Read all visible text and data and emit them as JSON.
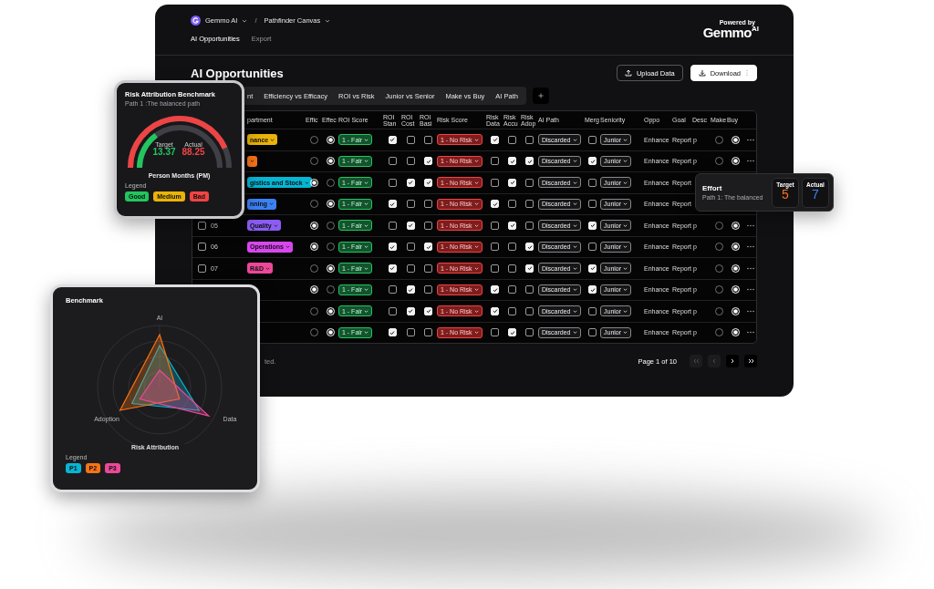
{
  "header": {
    "workspace": "Gemmo AI",
    "separator": "/",
    "project": "Pathfinder Canvas",
    "nav": [
      {
        "label": "AI Opportunities",
        "selected": true
      },
      {
        "label": "Export",
        "selected": false
      }
    ],
    "logo": {
      "badge": "Powered by",
      "name": "Gemmo",
      "suffix": "AI"
    }
  },
  "page_title": "AI Opportunities",
  "actions": [
    {
      "label": "Upload Data",
      "kind": "outline"
    },
    {
      "label": "Download",
      "kind": "primary"
    }
  ],
  "tabs": [
    {
      "label": "nt",
      "selected": false
    },
    {
      "label": "Efficiency vs Efficacy",
      "selected": false
    },
    {
      "label": "ROI vs Risk",
      "selected": false
    },
    {
      "label": "Junior vs Senior",
      "selected": false
    },
    {
      "label": "Make vs Buy",
      "selected": false
    },
    {
      "label": "AI Path",
      "selected": false
    }
  ],
  "table": {
    "columns": [
      "partment",
      "Effic",
      "Effec",
      "ROI Score",
      "ROI Stan",
      "ROI Cost",
      "ROI Basi",
      "Risk Score",
      "Risk Data",
      "Risk Accu",
      "Risk Adop",
      "AI Path",
      "Merg",
      "Seniority",
      "Oppo",
      "Goal",
      "Desc",
      "Make",
      "Buy"
    ],
    "rows": [
      {
        "department": {
          "label": "nance",
          "color": "#eab308"
        },
        "effic": {
          "selected": false
        },
        "effec": {
          "selected": true
        },
        "roi_score": "1 - Fair",
        "roi": [
          {
            "checked": true
          },
          {
            "checked": false
          },
          {
            "checked": false
          }
        ],
        "risk_score": "1 - No Risk",
        "risk": [
          {
            "checked": true
          },
          {
            "checked": false
          },
          {
            "checked": false
          }
        ],
        "ai_path": "Discarded",
        "merge": {
          "checked": false
        },
        "seniority": "Junior",
        "opportunity": "Enhance",
        "goal": "Report p",
        "make": {
          "selected": false
        },
        "buy": {
          "selected": true
        }
      },
      {
        "department": {
          "color": "#f97316"
        },
        "effic": {
          "selected": false
        },
        "effec": {
          "selected": true
        },
        "roi_score": "1 - Fair",
        "roi": [
          {
            "checked": false
          },
          {
            "checked": false
          },
          {
            "checked": true
          }
        ],
        "risk_score": "1 - No Risk",
        "risk": [
          {
            "checked": false
          },
          {
            "checked": true
          },
          {
            "checked": true
          }
        ],
        "ai_path": "Discarded",
        "merge": {
          "checked": true
        },
        "seniority": "Junior",
        "opportunity": "Enhance",
        "goal": "Report p",
        "make": {
          "selected": false
        },
        "buy": {
          "selected": true
        }
      },
      {
        "department": {
          "label": "gistics and Stock",
          "color": "#06b6d4"
        },
        "effic": {
          "selected": true
        },
        "effec": {
          "selected": false
        },
        "roi_score": "1 - Fair",
        "roi": [
          {
            "checked": false
          },
          {
            "checked": true
          },
          {
            "checked": true
          }
        ],
        "risk_score": "1 - No Risk",
        "risk": [
          {
            "checked": false
          },
          {
            "checked": true
          },
          {
            "checked": false
          }
        ],
        "ai_path": "Discarded",
        "merge": {
          "checked": false
        },
        "seniority": "Junior",
        "opportunity": "Enhance",
        "goal": "Report"
      },
      {
        "department": {
          "label": "nning",
          "color": "#3b82f6"
        },
        "effic": {
          "selected": false
        },
        "effec": {
          "selected": true
        },
        "roi_score": "1 - Fair",
        "roi": [
          {
            "checked": true
          },
          {
            "checked": false
          },
          {
            "checked": false
          }
        ],
        "risk_score": "1 - No Risk",
        "risk": [
          {
            "checked": true
          },
          {
            "checked": false
          },
          {
            "checked": false
          }
        ],
        "ai_path": "Discarded",
        "merge": {
          "checked": false
        },
        "seniority": "Junior",
        "opportunity": "Enhance",
        "goal": "Report"
      },
      {
        "checked": false,
        "number": "05",
        "department": {
          "label": "Quality",
          "color": "#8b5cf6"
        },
        "effic": {
          "selected": true
        },
        "effec": {
          "selected": false
        },
        "roi_score": "1 - Fair",
        "roi": [
          {
            "checked": false
          },
          {
            "checked": true
          },
          {
            "checked": false
          }
        ],
        "risk_score": "1 - No Risk",
        "risk": [
          {
            "checked": false
          },
          {
            "checked": true
          },
          {
            "checked": false
          }
        ],
        "ai_path": "Discarded",
        "merge": {
          "checked": true
        },
        "seniority": "Junior",
        "opportunity": "Enhance",
        "goal": "Report p",
        "make": {
          "selected": false
        },
        "buy": {
          "selected": true
        }
      },
      {
        "checked": false,
        "number": "06",
        "department": {
          "label": "Operations",
          "color": "#d946ef"
        },
        "effic": {
          "selected": true
        },
        "effec": {
          "selected": false
        },
        "roi_score": "1 - Fair",
        "roi": [
          {
            "checked": true
          },
          {
            "checked": false
          },
          {
            "checked": true
          }
        ],
        "risk_score": "1 - No Risk",
        "risk": [
          {
            "checked": false
          },
          {
            "checked": false
          },
          {
            "checked": true
          }
        ],
        "ai_path": "Discarded",
        "merge": {
          "checked": false
        },
        "seniority": "Junior",
        "opportunity": "Enhance",
        "goal": "Report p",
        "make": {
          "selected": false
        },
        "buy": {
          "selected": true
        }
      },
      {
        "checked": false,
        "number": "07",
        "department": {
          "label": "R&D",
          "color": "#ec4899"
        },
        "effic": {
          "selected": false
        },
        "effec": {
          "selected": true
        },
        "roi_score": "1 - Fair",
        "roi": [
          {
            "checked": true
          },
          {
            "checked": false
          },
          {
            "checked": false
          }
        ],
        "risk_score": "1 - No Risk",
        "risk": [
          {
            "checked": false
          },
          {
            "checked": false
          },
          {
            "checked": true
          }
        ],
        "ai_path": "Discarded",
        "merge": {
          "checked": true
        },
        "seniority": "Junior",
        "opportunity": "Enhance",
        "goal": "Report p",
        "make": {
          "selected": false
        },
        "buy": {
          "selected": true
        }
      },
      {
        "effic": {
          "selected": true
        },
        "effec": {
          "selected": false
        },
        "roi_score": "1 - Fair",
        "roi": [
          {
            "checked": false
          },
          {
            "checked": true
          },
          {
            "checked": false
          }
        ],
        "risk_score": "1 - No Risk",
        "risk": [
          {
            "checked": true
          },
          {
            "checked": false
          },
          {
            "checked": false
          }
        ],
        "ai_path": "Discarded",
        "merge": {
          "checked": true
        },
        "seniority": "Junior",
        "opportunity": "Enhance",
        "goal": "Report p",
        "make": {
          "selected": false
        },
        "buy": {
          "selected": true
        }
      },
      {
        "effic": {
          "selected": false
        },
        "effec": {
          "selected": true
        },
        "roi_score": "1 - Fair",
        "roi": [
          {
            "checked": false
          },
          {
            "checked": true
          },
          {
            "checked": true
          }
        ],
        "risk_score": "1 - No Risk",
        "risk": [
          {
            "checked": true
          },
          {
            "checked": false
          },
          {
            "checked": false
          }
        ],
        "ai_path": "Discarded",
        "merge": {
          "checked": false
        },
        "seniority": "Junior",
        "opportunity": "Enhance",
        "goal": "Report p",
        "make": {
          "selected": false
        },
        "buy": {
          "selected": true
        }
      },
      {
        "effic": {
          "selected": false
        },
        "effec": {
          "selected": true
        },
        "roi_score": "1 - Fair",
        "roi": [
          {
            "checked": true
          },
          {
            "checked": false
          },
          {
            "checked": false
          }
        ],
        "risk_score": "1 - No Risk",
        "risk": [
          {
            "checked": false
          },
          {
            "checked": true
          },
          {
            "checked": false
          }
        ],
        "ai_path": "Discarded",
        "merge": {
          "checked": false
        },
        "seniority": "Junior",
        "opportunity": "Enhance",
        "goal": "Report p",
        "make": {
          "selected": false
        },
        "buy": {
          "selected": true
        }
      }
    ]
  },
  "footer": {
    "selection_note": "ted.",
    "page": "Page 1 of 10",
    "pager": [
      {
        "kind": "first",
        "disabled": true
      },
      {
        "kind": "prev",
        "disabled": true
      },
      {
        "kind": "next",
        "disabled": false
      },
      {
        "kind": "last",
        "disabled": false
      }
    ]
  },
  "risk_card": {
    "title": "Risk Attribution Benchmark",
    "subtitle": "Path 1 :The balanced path",
    "target": {
      "label": "Target",
      "value": "13.37"
    },
    "actual": {
      "label": "Actual",
      "value": "88.25"
    },
    "unit": "Person Months (PM)",
    "legend_title": "Legend",
    "legend": [
      {
        "label": "Good",
        "color": "#22c55e"
      },
      {
        "label": "Medium",
        "color": "#eab308"
      },
      {
        "label": "Bad",
        "color": "#ef4444"
      }
    ]
  },
  "effort_card": {
    "title": "Effort",
    "subtitle": "Path 1: The balanced",
    "target": {
      "label": "Target",
      "value": "5"
    },
    "actual": {
      "label": "Actual",
      "value": "7"
    }
  },
  "benchmark_card": {
    "title": "Benchmark",
    "axes": [
      "AI",
      "Data",
      "Adoption"
    ],
    "xlabel": "Risk Attribution",
    "legend_title": "Legend",
    "series": [
      {
        "name": "P1",
        "color": "#06b6d4"
      },
      {
        "name": "P2",
        "color": "#f97316"
      },
      {
        "name": "P3",
        "color": "#ec4899"
      }
    ]
  }
}
